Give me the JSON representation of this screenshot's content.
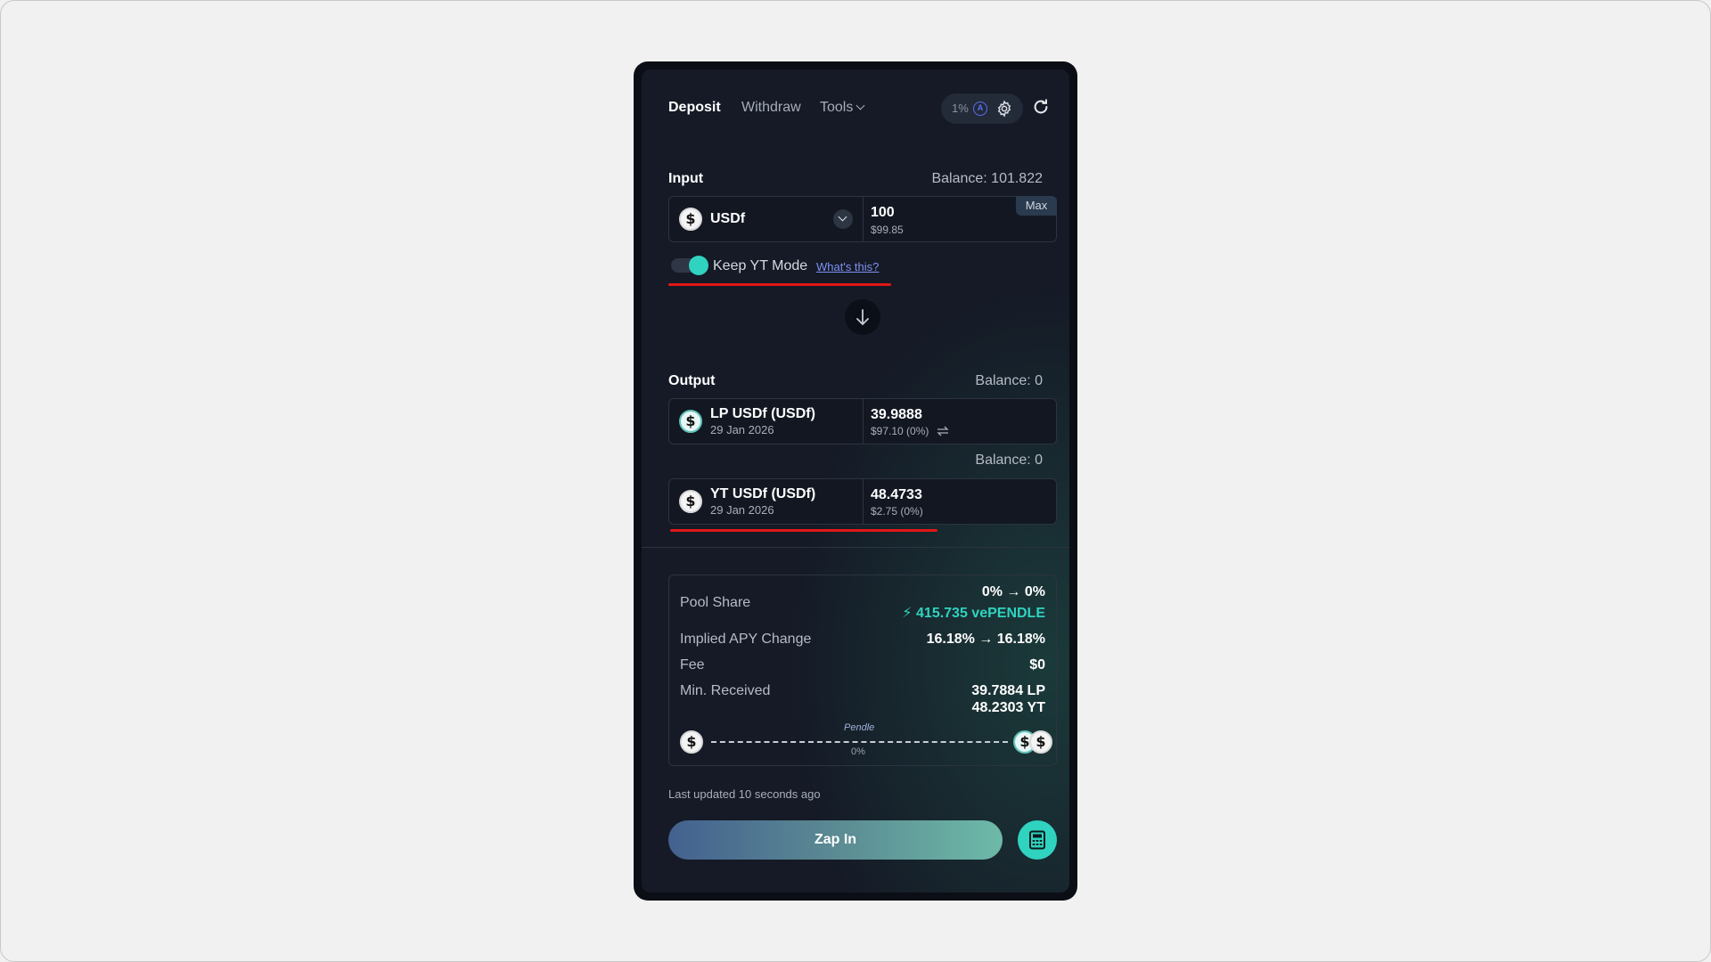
{
  "header": {
    "tabs": [
      {
        "label": "Deposit",
        "active": true
      },
      {
        "label": "Withdraw",
        "active": false
      },
      {
        "label": "Tools",
        "active": false
      }
    ],
    "slippage": "1%",
    "auto_badge": "A"
  },
  "input": {
    "label": "Input",
    "balance": "Balance: 101.822",
    "token": "USDf",
    "amount": "100",
    "amount_usd": "$99.85",
    "max_label": "Max"
  },
  "keep_yt": {
    "label": "Keep YT Mode",
    "link": "What's this?",
    "enabled": true
  },
  "output": {
    "label": "Output",
    "lp": {
      "balance": "Balance: 0",
      "name": "LP USDf (USDf)",
      "date": "29 Jan 2026",
      "amount": "39.9888",
      "amount_usd": "$97.10 (0%)"
    },
    "yt": {
      "balance": "Balance: 0",
      "name": "YT USDf (USDf)",
      "date": "29 Jan 2026",
      "amount": "48.4733",
      "amount_usd": "$2.75 (0%)"
    }
  },
  "summary": {
    "pool_share_label": "Pool Share",
    "pool_share_value": "0% → 0%",
    "vependle": "415.735 vePENDLE",
    "apy_label": "Implied APY Change",
    "apy_value": "16.18% → 16.18%",
    "fee_label": "Fee",
    "fee_value": "$0",
    "min_label": "Min. Received",
    "min_lp": "39.7884 LP",
    "min_yt": "48.2303 YT",
    "route_tag": "Pendle",
    "route_pct": "0%"
  },
  "footer": {
    "updated": "Last updated 10 seconds ago",
    "zap_label": "Zap In"
  },
  "colors": {
    "accent": "#2fd3bf",
    "link": "#7f91f2",
    "highlight_underline": "#e21717",
    "panel_bg": "#151a26"
  }
}
